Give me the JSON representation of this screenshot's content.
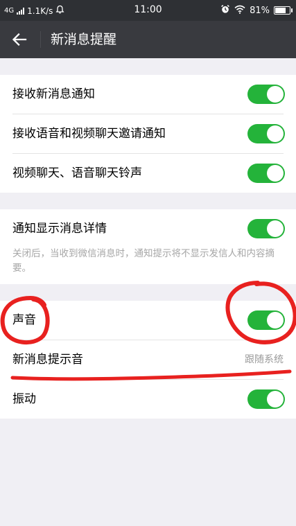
{
  "status_bar": {
    "network": "4G",
    "speed": "1.1K/s",
    "time": "11:00",
    "battery": "81%",
    "battery_level": 0.81
  },
  "app_bar": {
    "title": "新消息提醒"
  },
  "settings": {
    "group1": [
      {
        "label": "接收新消息通知",
        "on": true
      },
      {
        "label": "接收语音和视频聊天邀请通知",
        "on": true
      },
      {
        "label": "视频聊天、语音聊天铃声",
        "on": true
      }
    ],
    "group2": {
      "label": "通知显示消息详情",
      "on": true,
      "description": "关闭后，当收到微信消息时，通知提示将不显示发信人和内容摘要。"
    },
    "group3": {
      "sound": {
        "label": "声音",
        "on": true
      },
      "ringtone": {
        "label": "新消息提示音",
        "value": "跟随系统"
      },
      "vibrate": {
        "label": "振动",
        "on": true
      }
    }
  },
  "colors": {
    "toggle_on": "#24b33a",
    "app_bar": "#393a3f",
    "status_bar": "#2e3034",
    "background": "#f0eff4",
    "annotation": "#e8211f"
  }
}
